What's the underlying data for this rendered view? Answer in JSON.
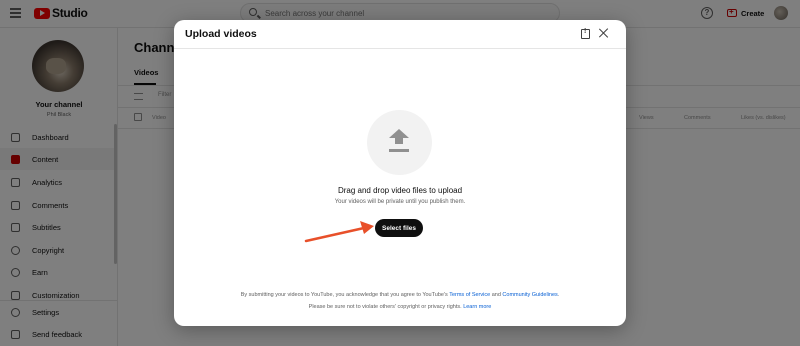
{
  "app": {
    "brand": "Studio",
    "search_placeholder": "Search across your channel",
    "help_label": "?",
    "create_label": "Create",
    "accent_color": "#ff0000"
  },
  "sidebar": {
    "channel_name": "Your channel",
    "handle": "Phil Black",
    "items": [
      {
        "label": "Dashboard",
        "icon": "dashboard-icon"
      },
      {
        "label": "Content",
        "icon": "content-icon",
        "active": true
      },
      {
        "label": "Analytics",
        "icon": "analytics-icon"
      },
      {
        "label": "Comments",
        "icon": "comments-icon"
      },
      {
        "label": "Subtitles",
        "icon": "subtitles-icon"
      },
      {
        "label": "Copyright",
        "icon": "copyright-icon"
      },
      {
        "label": "Earn",
        "icon": "earn-icon"
      },
      {
        "label": "Customization",
        "icon": "customization-icon"
      }
    ],
    "bottom_items": [
      {
        "label": "Settings",
        "icon": "gear-icon"
      },
      {
        "label": "Send feedback",
        "icon": "feedback-icon"
      }
    ]
  },
  "main": {
    "title": "Channel",
    "tab": "Videos",
    "filter_placeholder": "Filter",
    "columns": {
      "video": "Video",
      "views": "Views",
      "comments": "Comments",
      "likes": "Likes (vs. dislikes)"
    }
  },
  "modal": {
    "title": "Upload videos",
    "drag_text": "Drag and drop video files to upload",
    "private_text": "Your videos will be private until you publish them.",
    "select_button": "Select files",
    "terms_prefix": "By submitting your videos to YouTube, you acknowledge that you agree to YouTube's",
    "terms_link": "Terms of Service",
    "terms_and": "and",
    "guidelines_link": "Community Guidelines",
    "terms_end": ".",
    "copyright_text": "Please be sure not to violate others' copyright or privacy rights.",
    "learn_more": "Learn more",
    "annotation_arrow_color": "#e8502a"
  }
}
